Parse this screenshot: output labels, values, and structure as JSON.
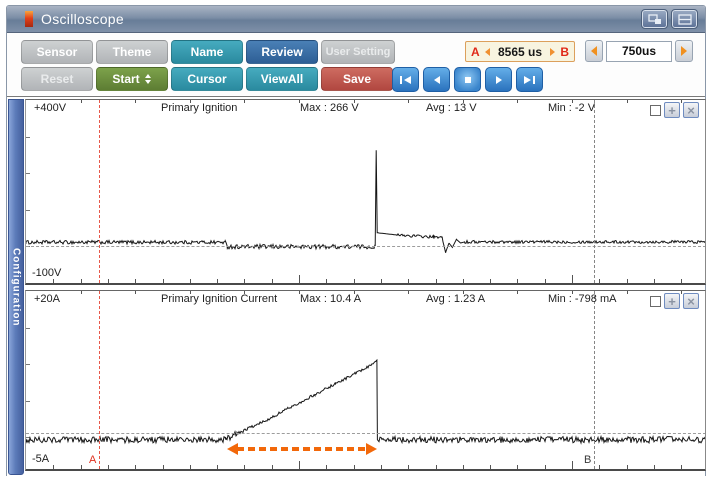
{
  "window": {
    "title": "Oscilloscope"
  },
  "toolbar": {
    "sensor": "Sensor",
    "theme": "Theme",
    "name": "Name",
    "review": "Review",
    "user_setting": "User Setting",
    "reset": "Reset",
    "start": "Start",
    "cursor": "Cursor",
    "viewall": "ViewAll",
    "save": "Save"
  },
  "ab_readout": {
    "a_label": "A",
    "value": "8565 us",
    "b_label": "B"
  },
  "timebase": {
    "value": "750us"
  },
  "sidebar": {
    "label": "Configuration"
  },
  "cursors": {
    "a": "A",
    "b": "B",
    "a_frac": 0.1074,
    "b_frac": 0.8353,
    "a_color": "#e8584a",
    "b_color": "#858585"
  },
  "ui": {
    "zoom_glyph": "+",
    "close_glyph": "×"
  },
  "chart_data": [
    {
      "type": "line",
      "title": "Primary Ignition",
      "scale_top": "+400V",
      "scale_bottom": "-100V",
      "stats": {
        "max": "Max : 266 V",
        "avg": "Avg : 13 V",
        "min": "Min : -2 V"
      },
      "ylim": [
        -100,
        400
      ],
      "unit": "V",
      "grid": false,
      "anchors": [
        [
          0.0,
          14,
          5
        ],
        [
          0.293,
          14,
          5
        ],
        [
          0.296,
          2,
          6
        ],
        [
          0.5135,
          2,
          3
        ],
        [
          0.515,
          266,
          0
        ],
        [
          0.5165,
          40,
          0
        ],
        [
          0.545,
          34,
          4
        ],
        [
          0.6,
          28,
          3
        ],
        [
          0.612,
          27,
          2
        ],
        [
          0.617,
          -14,
          0
        ],
        [
          0.622,
          12,
          0
        ],
        [
          0.627,
          0,
          0
        ],
        [
          0.633,
          22,
          0
        ],
        [
          0.639,
          12,
          0
        ],
        [
          0.645,
          15,
          4
        ],
        [
          1.0,
          15,
          0
        ]
      ]
    },
    {
      "type": "line",
      "title": "Primary Ignition Current",
      "scale_top": "+20A",
      "scale_bottom": "-5A",
      "stats": {
        "max": "Max : 10.4 A",
        "avg": "Avg : 1.23 A",
        "min": "Min : -798 mA"
      },
      "ylim": [
        -5,
        20
      ],
      "unit": "A",
      "grid": false,
      "annotation": {
        "type": "double-arrow",
        "x0": 0.296,
        "x1": 0.517,
        "color": "#f2680a"
      },
      "anchors": [
        [
          0.0,
          -0.75,
          0.45
        ],
        [
          0.294,
          -0.75,
          0.45
        ],
        [
          0.31,
          0.1,
          0.2
        ],
        [
          0.345,
          1.6,
          0.2
        ],
        [
          0.385,
          3.6,
          0.2
        ],
        [
          0.425,
          5.6,
          0.2
        ],
        [
          0.455,
          7.1,
          0.18
        ],
        [
          0.485,
          8.6,
          0.15
        ],
        [
          0.505,
          9.6,
          0.12
        ],
        [
          0.5155,
          10.35,
          0.05
        ],
        [
          0.516,
          10.4,
          0
        ],
        [
          0.5168,
          -0.75,
          0.45
        ],
        [
          1.0,
          -0.75,
          0
        ]
      ]
    }
  ]
}
